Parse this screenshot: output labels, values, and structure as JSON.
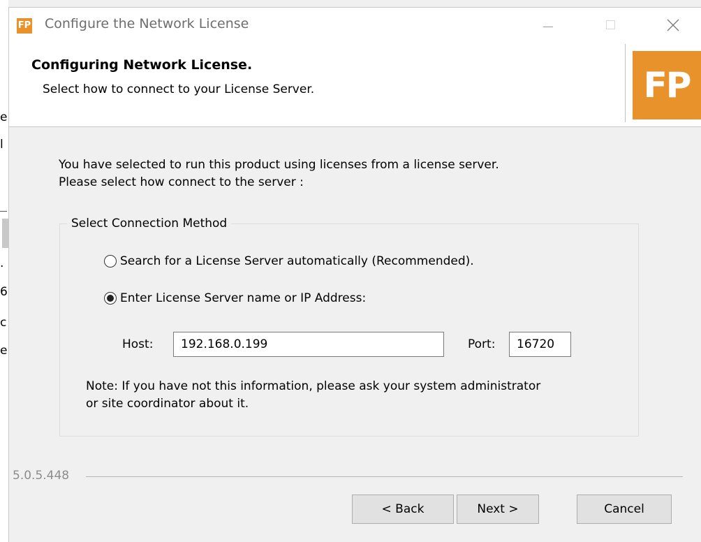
{
  "window": {
    "app_icon_text": "FP",
    "title": "Configure the Network License"
  },
  "header": {
    "title": "Configuring Network License.",
    "subtitle": "Select how to connect to your License Server.",
    "logo_text": "FP"
  },
  "intro": {
    "line1": "You have selected to run this product using licenses from a license server.",
    "line2": "Please select how connect to the server :"
  },
  "connection": {
    "group_label": "Select Connection Method",
    "option_auto": "Search for a License Server automatically (Recommended).",
    "option_manual": "Enter License Server name or IP Address:",
    "selected": "manual",
    "host_label": "Host:",
    "host_value": "192.168.0.199",
    "port_label": "Port:",
    "port_value": "16720",
    "note_line1": "Note: If you have not this information, please ask your system administrator",
    "note_line2": "or site coordinator about it."
  },
  "footer": {
    "version": "5.0.5.448",
    "back_label": "< Back",
    "next_label": "Next >",
    "cancel_label": "Cancel"
  },
  "colors": {
    "brand_orange": "#e8922c",
    "dialog_bg": "#f0f0f0"
  }
}
